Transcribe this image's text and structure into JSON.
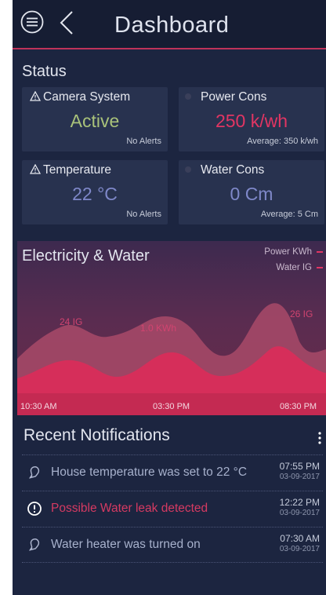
{
  "header": {
    "title": "Dashboard",
    "menu_icon": "menu-icon",
    "back_icon": "chevron-left-icon"
  },
  "status": {
    "title": "Status",
    "cards": [
      {
        "label": "Camera System",
        "value": "Active",
        "note": "No Alerts",
        "value_color": "#a9c27a",
        "icon": "warning-icon"
      },
      {
        "label": "Power Cons",
        "value": "250 k/wh",
        "note": "Average: 350 k/wh",
        "value_color": "#e23563",
        "icon": "dot-icon"
      },
      {
        "label": "Temperature",
        "value": "22 °C",
        "note": "No Alerts",
        "value_color": "#7f88c9",
        "icon": "warning-icon"
      },
      {
        "label": "Water Cons",
        "value": "0 Cm",
        "note": "Average: 5  Cm",
        "value_color": "#7f88c9",
        "icon": "dot-icon"
      }
    ]
  },
  "chart": {
    "title": "Electricity & Water",
    "legend": [
      "Power KWh",
      "Water IG"
    ],
    "annotations": [
      "24 IG",
      "1.0 KWh",
      "26 IG"
    ],
    "time_labels": [
      "10:30 AM",
      "03:30 PM",
      "08:30 PM"
    ],
    "accent": "#e23563"
  },
  "chart_data": {
    "type": "area",
    "title": "Electricity & Water",
    "x": [
      "10:30 AM",
      "03:30 PM",
      "08:30 PM"
    ],
    "series": [
      {
        "name": "Power KWh",
        "values": []
      },
      {
        "name": "Water IG",
        "values": []
      }
    ],
    "annotations": [
      "24 IG",
      "1.0 KWh",
      "26 IG"
    ],
    "legend_position": "top-right"
  },
  "notifications": {
    "title": "Recent Notifications",
    "items": [
      {
        "text": "House temperature was set to 22 °C",
        "time": "07:55 PM",
        "date": "03-09-2017",
        "icon": "bell-icon",
        "alert": false
      },
      {
        "text": "Possible Water leak detected",
        "time": "12:22 PM",
        "date": "03-09-2017",
        "icon": "alert-circle-icon",
        "alert": true
      },
      {
        "text": "Water heater was turned on",
        "time": "07:30 AM",
        "date": "03-09-2017",
        "icon": "bell-icon",
        "alert": false
      }
    ]
  }
}
